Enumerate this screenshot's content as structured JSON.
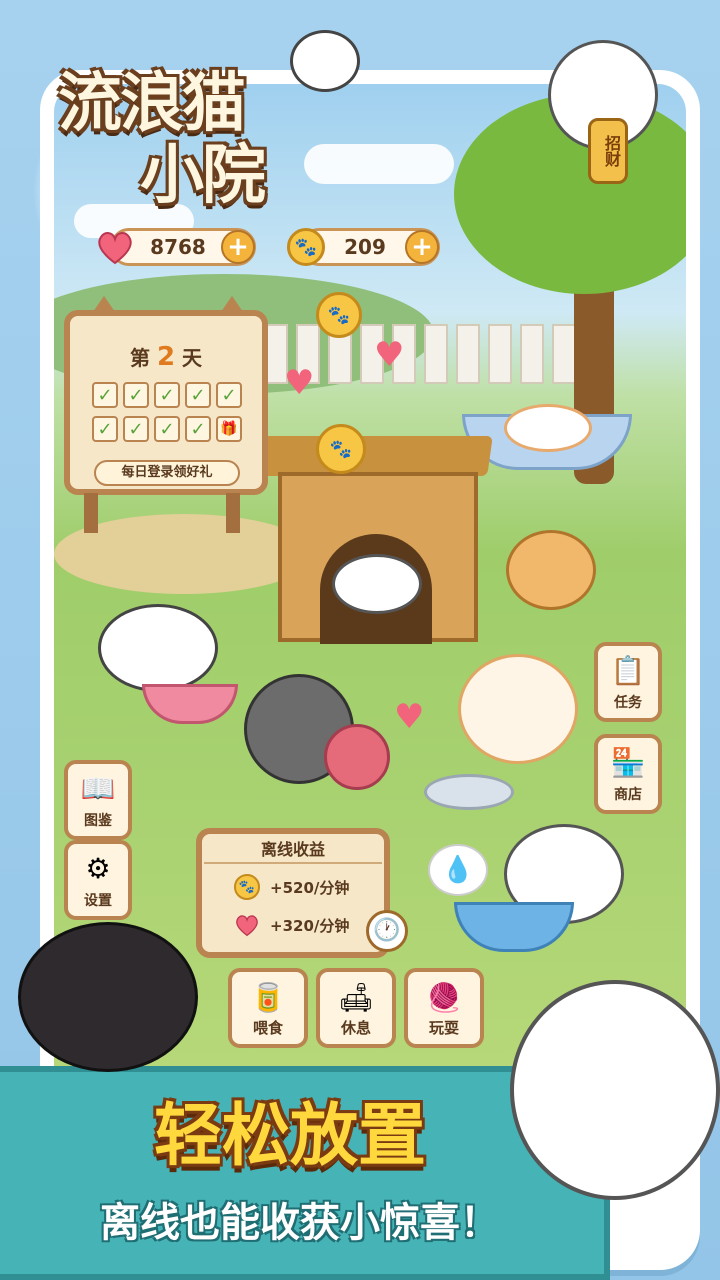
{
  "title": {
    "line1": "流浪猫",
    "line2": "小院"
  },
  "currency": {
    "hearts": "8768",
    "coins": "209",
    "add_symbol": "+"
  },
  "checkin": {
    "day_prefix": "第",
    "day_number": "2",
    "day_suffix": "天",
    "grid": [
      "✓",
      "✓",
      "✓",
      "✓",
      "✓",
      "✓",
      "✓",
      "✓",
      "✓",
      "🎁"
    ],
    "claim_label": "每日登录领好礼"
  },
  "sign_maneki": "招财",
  "side_left": [
    {
      "label": "图鉴",
      "icon": "book-icon"
    },
    {
      "label": "设置",
      "icon": "gear-icon"
    }
  ],
  "side_right": [
    {
      "label": "任务",
      "icon": "clipboard-icon"
    },
    {
      "label": "商店",
      "icon": "shop-icon"
    }
  ],
  "income": {
    "title": "离线收益",
    "coin_rate": "+520/分钟",
    "heart_rate": "+320/分钟"
  },
  "actions": [
    {
      "label": "喂食",
      "icon": "can-icon"
    },
    {
      "label": "休息",
      "icon": "sofa-icon"
    },
    {
      "label": "玩耍",
      "icon": "yarn-icon"
    }
  ],
  "banner": {
    "slogan": "轻松放置",
    "subtitle": "离线也能收获小惊喜！"
  },
  "colors": {
    "wood": "#b98450",
    "heart": "#f1647b",
    "coin": "#f7c645",
    "banner": "#46b3b6",
    "slogan": "#ffd83d"
  }
}
